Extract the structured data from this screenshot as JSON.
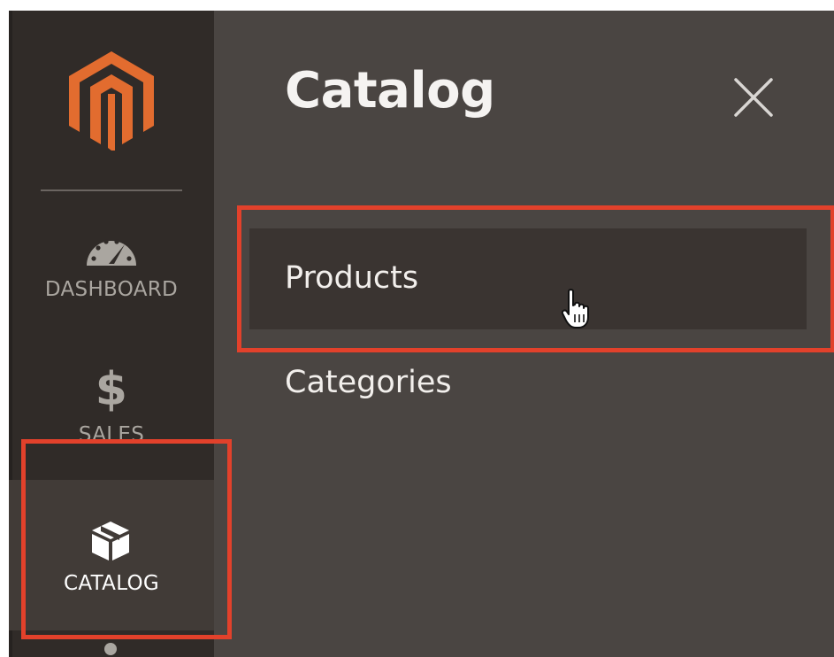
{
  "sidebar": {
    "logo_icon": "magento-logo-icon",
    "items": [
      {
        "key": "dashboard",
        "label": "DASHBOARD",
        "icon": "speedometer-icon"
      },
      {
        "key": "sales",
        "label": "SALES",
        "icon": "dollar-icon",
        "icon_glyph": "$"
      },
      {
        "key": "catalog",
        "label": "CATALOG",
        "icon": "box-icon",
        "active": true
      }
    ]
  },
  "panel": {
    "title": "Catalog",
    "close_icon": "close-icon",
    "items": [
      {
        "label": "Products",
        "hovered": true
      },
      {
        "label": "Categories"
      }
    ]
  },
  "colors": {
    "sidebar_bg": "#302b28",
    "sidebar_active_bg": "#413b37",
    "panel_bg": "#4a4542",
    "hover_item_bg": "#3a3431",
    "brand_orange": "#e26c2f",
    "highlight_red": "#e2412b",
    "nav_text": "#aaa6a0"
  }
}
